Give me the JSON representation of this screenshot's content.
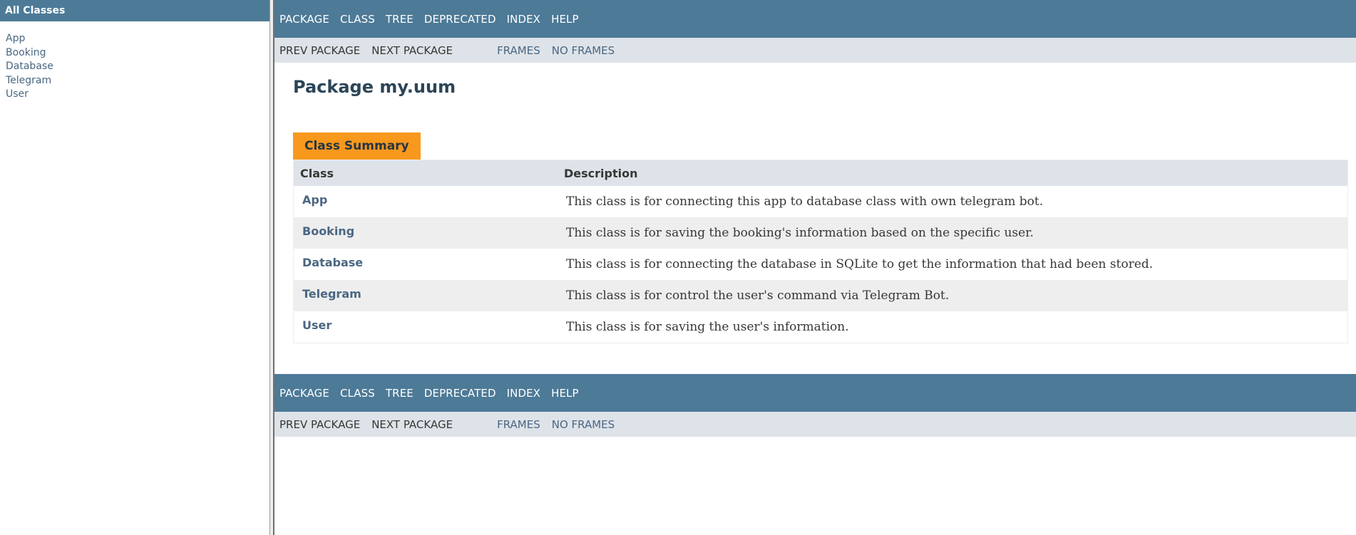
{
  "left_frame": {
    "heading": "All Classes",
    "classes": [
      "App",
      "Booking",
      "Database",
      "Telegram",
      "User"
    ]
  },
  "nav": {
    "top": [
      "PACKAGE",
      "CLASS",
      "TREE",
      "DEPRECATED",
      "INDEX",
      "HELP"
    ],
    "sub": {
      "prev": "PREV PACKAGE",
      "next": "NEXT PACKAGE",
      "frames": "FRAMES",
      "no_frames": "NO FRAMES"
    }
  },
  "page": {
    "title": "Package my.uum"
  },
  "summary": {
    "caption": "Class Summary",
    "headers": {
      "class": "Class",
      "description": "Description"
    },
    "rows": [
      {
        "name": "App",
        "description": "This class is for connecting this app to database class with own telegram bot."
      },
      {
        "name": "Booking",
        "description": "This class is for saving the booking's information based on the specific user."
      },
      {
        "name": "Database",
        "description": "This class is for connecting the database in SQLite to get the information that had been stored."
      },
      {
        "name": "Telegram",
        "description": "This class is for control the user's command via Telegram Bot."
      },
      {
        "name": "User",
        "description": "This class is for saving the user's information."
      }
    ]
  },
  "colors": {
    "nav_bar": "#4d7a97",
    "sub_nav": "#dee3e9",
    "caption_tab": "#f8981d",
    "link": "#4a6782"
  }
}
